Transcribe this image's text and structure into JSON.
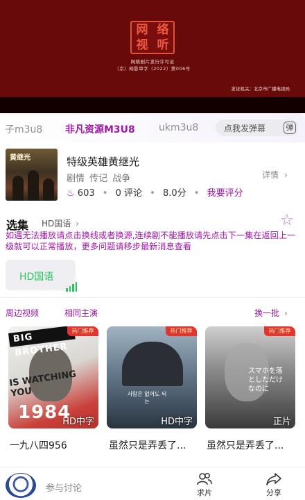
{
  "player": {
    "seal_chars": [
      "网",
      "络",
      "视",
      "听"
    ],
    "license_line1": "网络剧片发行许可证",
    "license_line2": "（京）网影审字（2022）第006号",
    "issuer": "发证机关：北京市广播电视局"
  },
  "sources": {
    "items": [
      {
        "label": "子m3u8",
        "active": false
      },
      {
        "label": "非凡资源M3U8",
        "active": true
      },
      {
        "label": "ukm3u8",
        "active": false
      }
    ],
    "danmu_label": "点我发弹幕",
    "danmu_icon_char": "弹"
  },
  "movie": {
    "poster_title": "黄继光",
    "title": "特级英雄黄继光",
    "tags": "剧情 传记 战争",
    "detail_label": "详情",
    "heat": "603",
    "comments": "0 评论",
    "score": "8.0分",
    "rate_label": "我要评分"
  },
  "episodes": {
    "title": "选集",
    "source_name": "HD国语",
    "notice": "如遇无法播放请点击换线或者换源,连续剧不能播放请先点击下一集在返回上一级就可以正常播放，更多问题请移步最新消息查看",
    "items": [
      {
        "label": "HD国语",
        "playing": true
      }
    ]
  },
  "related": {
    "tabs": [
      "周边视频",
      "相同主演"
    ],
    "refresh_label": "换一批",
    "cards": [
      {
        "title": "一九八四956",
        "quality": "HD中字",
        "badge": "热门推荐",
        "poster_text1": "BIG BROTHER",
        "poster_text2": "IS WATCHING YOU",
        "poster_text3": "1984"
      },
      {
        "title": "虽然只是弄丢了...",
        "quality": "HD中字",
        "badge": "热门推荐",
        "poster_text1": "사랑은 없어도 되는"
      },
      {
        "title": "虽然只是弄丢了...",
        "quality": "正片",
        "badge": "热门推荐",
        "poster_text1": "スマホを落としただけなのに"
      }
    ]
  },
  "bottom": {
    "discuss_placeholder": "参与讨论",
    "nav": [
      {
        "label": "求片",
        "icon": "people-icon"
      },
      {
        "label": "分享",
        "icon": "share-icon"
      }
    ]
  },
  "colors": {
    "accent": "#9e18a8",
    "player_bg": "#6e0b0b",
    "playing_green": "#2bc45b",
    "hot_badge": "#e0362f"
  }
}
